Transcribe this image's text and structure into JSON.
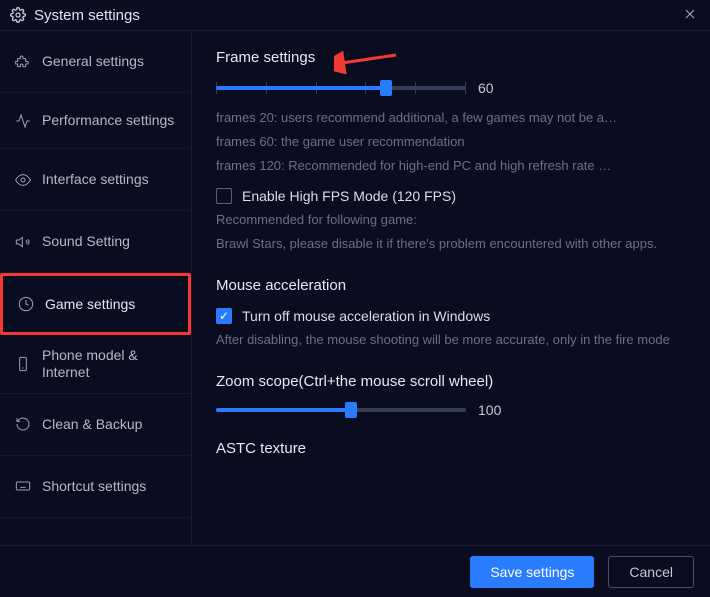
{
  "window": {
    "title": "System settings"
  },
  "sidebar": {
    "items": [
      {
        "label": "General settings",
        "icon": "puzzle"
      },
      {
        "label": "Performance settings",
        "icon": "activity"
      },
      {
        "label": "Interface settings",
        "icon": "eye"
      },
      {
        "label": "Sound Setting",
        "icon": "sound"
      },
      {
        "label": "Game settings",
        "icon": "gamepad",
        "highlighted": true
      },
      {
        "label": "Phone model & Internet",
        "icon": "phone"
      },
      {
        "label": "Clean & Backup",
        "icon": "restore"
      },
      {
        "label": "Shortcut settings",
        "icon": "keyboard"
      }
    ]
  },
  "frame": {
    "title": "Frame settings",
    "value": "60",
    "percent": 68,
    "desc1": "frames 20: users recommend additional, a few games may not be a…",
    "desc2": "frames 60: the game user recommendation",
    "desc3": "frames 120: Recommended for high-end PC and high refresh rate …",
    "highfps_label": "Enable High FPS Mode (120 FPS)",
    "highfps_checked": false,
    "highfps_desc1": "Recommended for following game:",
    "highfps_desc2": "Brawl Stars, please disable it if there's problem encountered with other apps."
  },
  "mouse": {
    "title": "Mouse acceleration",
    "turnoff_label": "Turn off mouse acceleration in Windows",
    "turnoff_checked": true,
    "desc": "After disabling, the mouse shooting will be more accurate, only in the fire mode"
  },
  "zoom": {
    "title": "Zoom scope(Ctrl+the mouse scroll wheel)",
    "value": "100",
    "percent": 54
  },
  "astc": {
    "title": "ASTC texture"
  },
  "footer": {
    "save": "Save settings",
    "cancel": "Cancel"
  },
  "colors": {
    "accent": "#2a7cff",
    "highlight": "#f33a32"
  }
}
